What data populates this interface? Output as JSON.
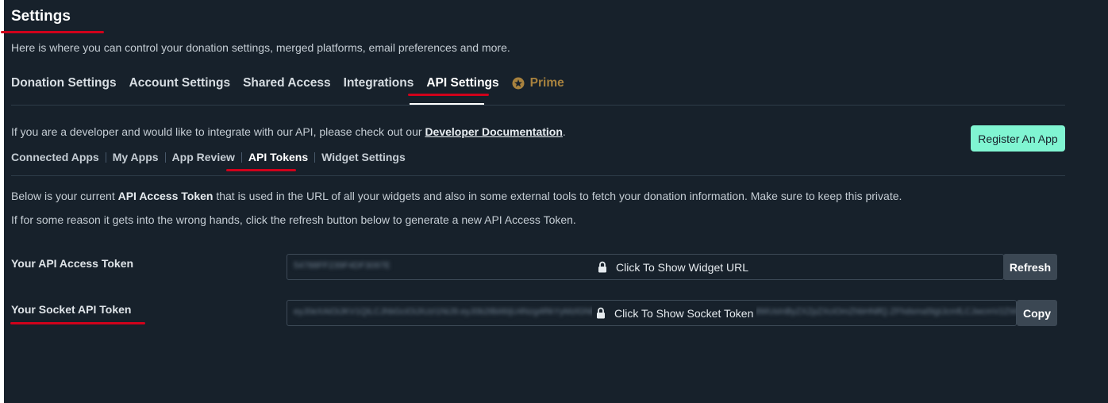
{
  "header": {
    "title": "Settings",
    "subtitle": "Here is where you can control your donation settings, merged platforms, email preferences and more."
  },
  "tabs": [
    {
      "label": "Donation Settings"
    },
    {
      "label": "Account Settings"
    },
    {
      "label": "Shared Access"
    },
    {
      "label": "Integrations"
    },
    {
      "label": "API Settings",
      "active": true
    },
    {
      "label": "Prime",
      "icon": "star-badge-icon"
    }
  ],
  "api": {
    "info_prefix": "If you are a developer and would like to integrate with our API, please check out our ",
    "doc_link": "Developer Documentation",
    "info_suffix": ".",
    "register_label": "Register An App",
    "subtabs": [
      {
        "label": "Connected Apps"
      },
      {
        "label": "My Apps"
      },
      {
        "label": "App Review"
      },
      {
        "label": "API Tokens",
        "active": true
      },
      {
        "label": "Widget Settings"
      }
    ],
    "para1_a": "Below is your current ",
    "para1_b": "API Access Token",
    "para1_c": " that is used in the URL of all your widgets and also in some external tools to fetch your donation information. Make sure to keep this private.",
    "para2": "If for some reason it gets into the wrong hands, click the refresh button below to generate a new API Access Token.",
    "access_token": {
      "label": "Your API Access Token",
      "blurred_value": "54788FF239F4DF3097E",
      "overlay": "Click To Show Widget URL",
      "button": "Refresh"
    },
    "socket_token": {
      "label": "Your Socket API Token",
      "blurred_value": "eyJ0eXAiOiJKV1QiLCJhbGciOiJIUzI1NiJ9.eyJ0b2tlbiI6IjU4Nzg4RkYyMzlGNERGMzA5N0UiLCJyZWFkX29ubHkiOnRydWUsInByZXZpZXciOmZhbHNlfQ.ZFhdsma5tgIJcmfLCJwcmV2ZW5 0K2Yw3Wo",
      "overlay": "Click To Show Socket Token",
      "button": "Copy"
    }
  },
  "colors": {
    "background": "#17212b",
    "accent": "#80f5d2",
    "prime": "#a8823e",
    "annotation": "#d0021b"
  }
}
